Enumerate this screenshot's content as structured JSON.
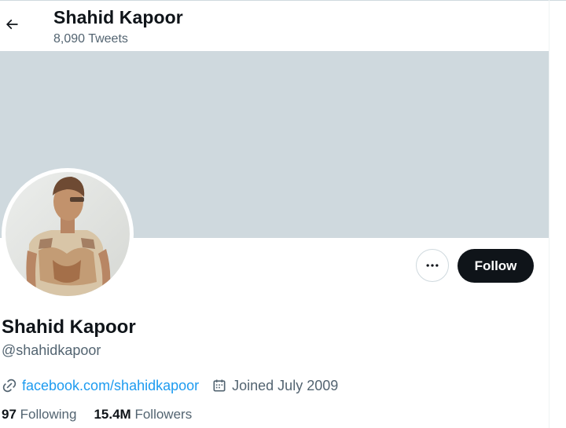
{
  "header": {
    "title": "Shahid Kapoor",
    "tweet_count": "8,090 Tweets",
    "back_icon": "arrow-left-icon"
  },
  "actions": {
    "more_icon": "more-horizontal-icon",
    "follow_label": "Follow"
  },
  "profile": {
    "display_name": "Shahid Kapoor",
    "handle": "@shahidkapoor",
    "website": "facebook.com/shahidkapoor",
    "joined": "Joined July 2009",
    "following_count": "97",
    "following_label": "Following",
    "followers_count": "15.4M",
    "followers_label": "Followers"
  },
  "colors": {
    "banner": "#cfd9de",
    "link": "#1d9bf0",
    "follow_button": "#0f1419",
    "secondary_text": "#536471"
  }
}
